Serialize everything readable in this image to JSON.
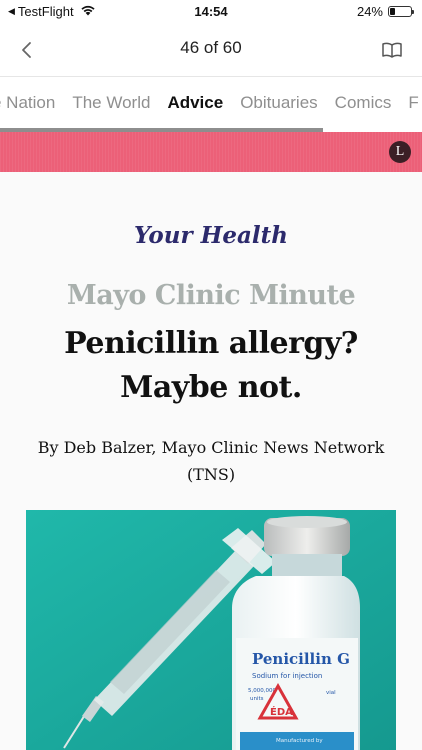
{
  "status_bar": {
    "back_app": "TestFlight",
    "time": "14:54",
    "battery_percent": "24%",
    "battery_level": 0.24
  },
  "nav": {
    "page_counter": "46 of 60"
  },
  "tabs": [
    {
      "label": "e Nation",
      "active": false
    },
    {
      "label": "The World",
      "active": false
    },
    {
      "label": "Advice",
      "active": true
    },
    {
      "label": "Obituaries",
      "active": false
    },
    {
      "label": "Comics",
      "active": false
    },
    {
      "label": "F",
      "active": false
    }
  ],
  "banner": {
    "logo_letter": "L",
    "color": "#ec6078"
  },
  "article": {
    "kicker": "Your Health",
    "series": "Mayo Clinic Minute",
    "headline": "Penicillin allergy? Maybe not.",
    "byline": "By Deb Balzer, Mayo Clinic News Network (TNS)"
  },
  "photo": {
    "vial_label_title": "Penicillin G",
    "vial_label_sub": "Sodium for  injection",
    "vial_label_units": "5,000,000",
    "vial_label_units_word": "units",
    "vial_label_vial": "vial",
    "vial_label_manufactured": "Manufactured by"
  },
  "colors": {
    "kicker": "#2c2a6c",
    "series": "#a9b0ad",
    "photo_bg": "#1fb3a6"
  }
}
